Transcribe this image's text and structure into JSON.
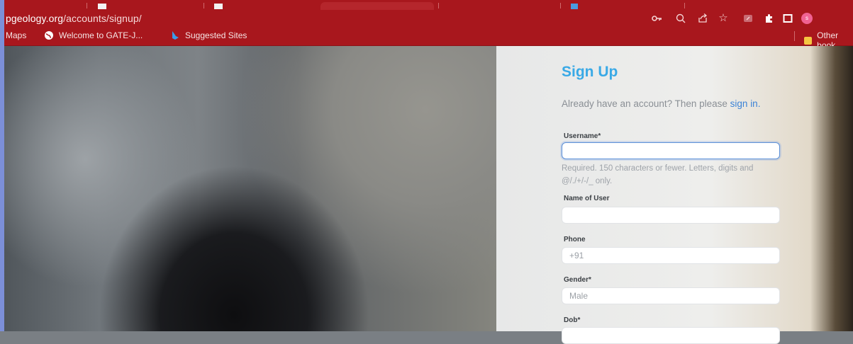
{
  "browser": {
    "url_host": "pgeology.org",
    "url_path": "/accounts/signup/",
    "profile_initial": "s",
    "bookmarks": [
      {
        "label": "Maps"
      },
      {
        "label": "Welcome to GATE-J..."
      },
      {
        "label": "Suggested Sites"
      }
    ],
    "other_bookmarks": "Other book"
  },
  "form": {
    "title": "Sign Up",
    "signin_prompt": "Already have an account? Then please ",
    "signin_link": "sign in.",
    "username_label": "Username*",
    "username_help": "Required. 150 characters or fewer. Letters, digits and @/./+/-/_ only.",
    "name_label": "Name of User",
    "phone_label": "Phone",
    "phone_value": "+91",
    "gender_label": "Gender*",
    "gender_value": "Male",
    "dob_label": "Dob*"
  },
  "colors": {
    "browser_chrome": "#a8171d",
    "title": "#39a9e6",
    "link": "#3b82d6"
  }
}
